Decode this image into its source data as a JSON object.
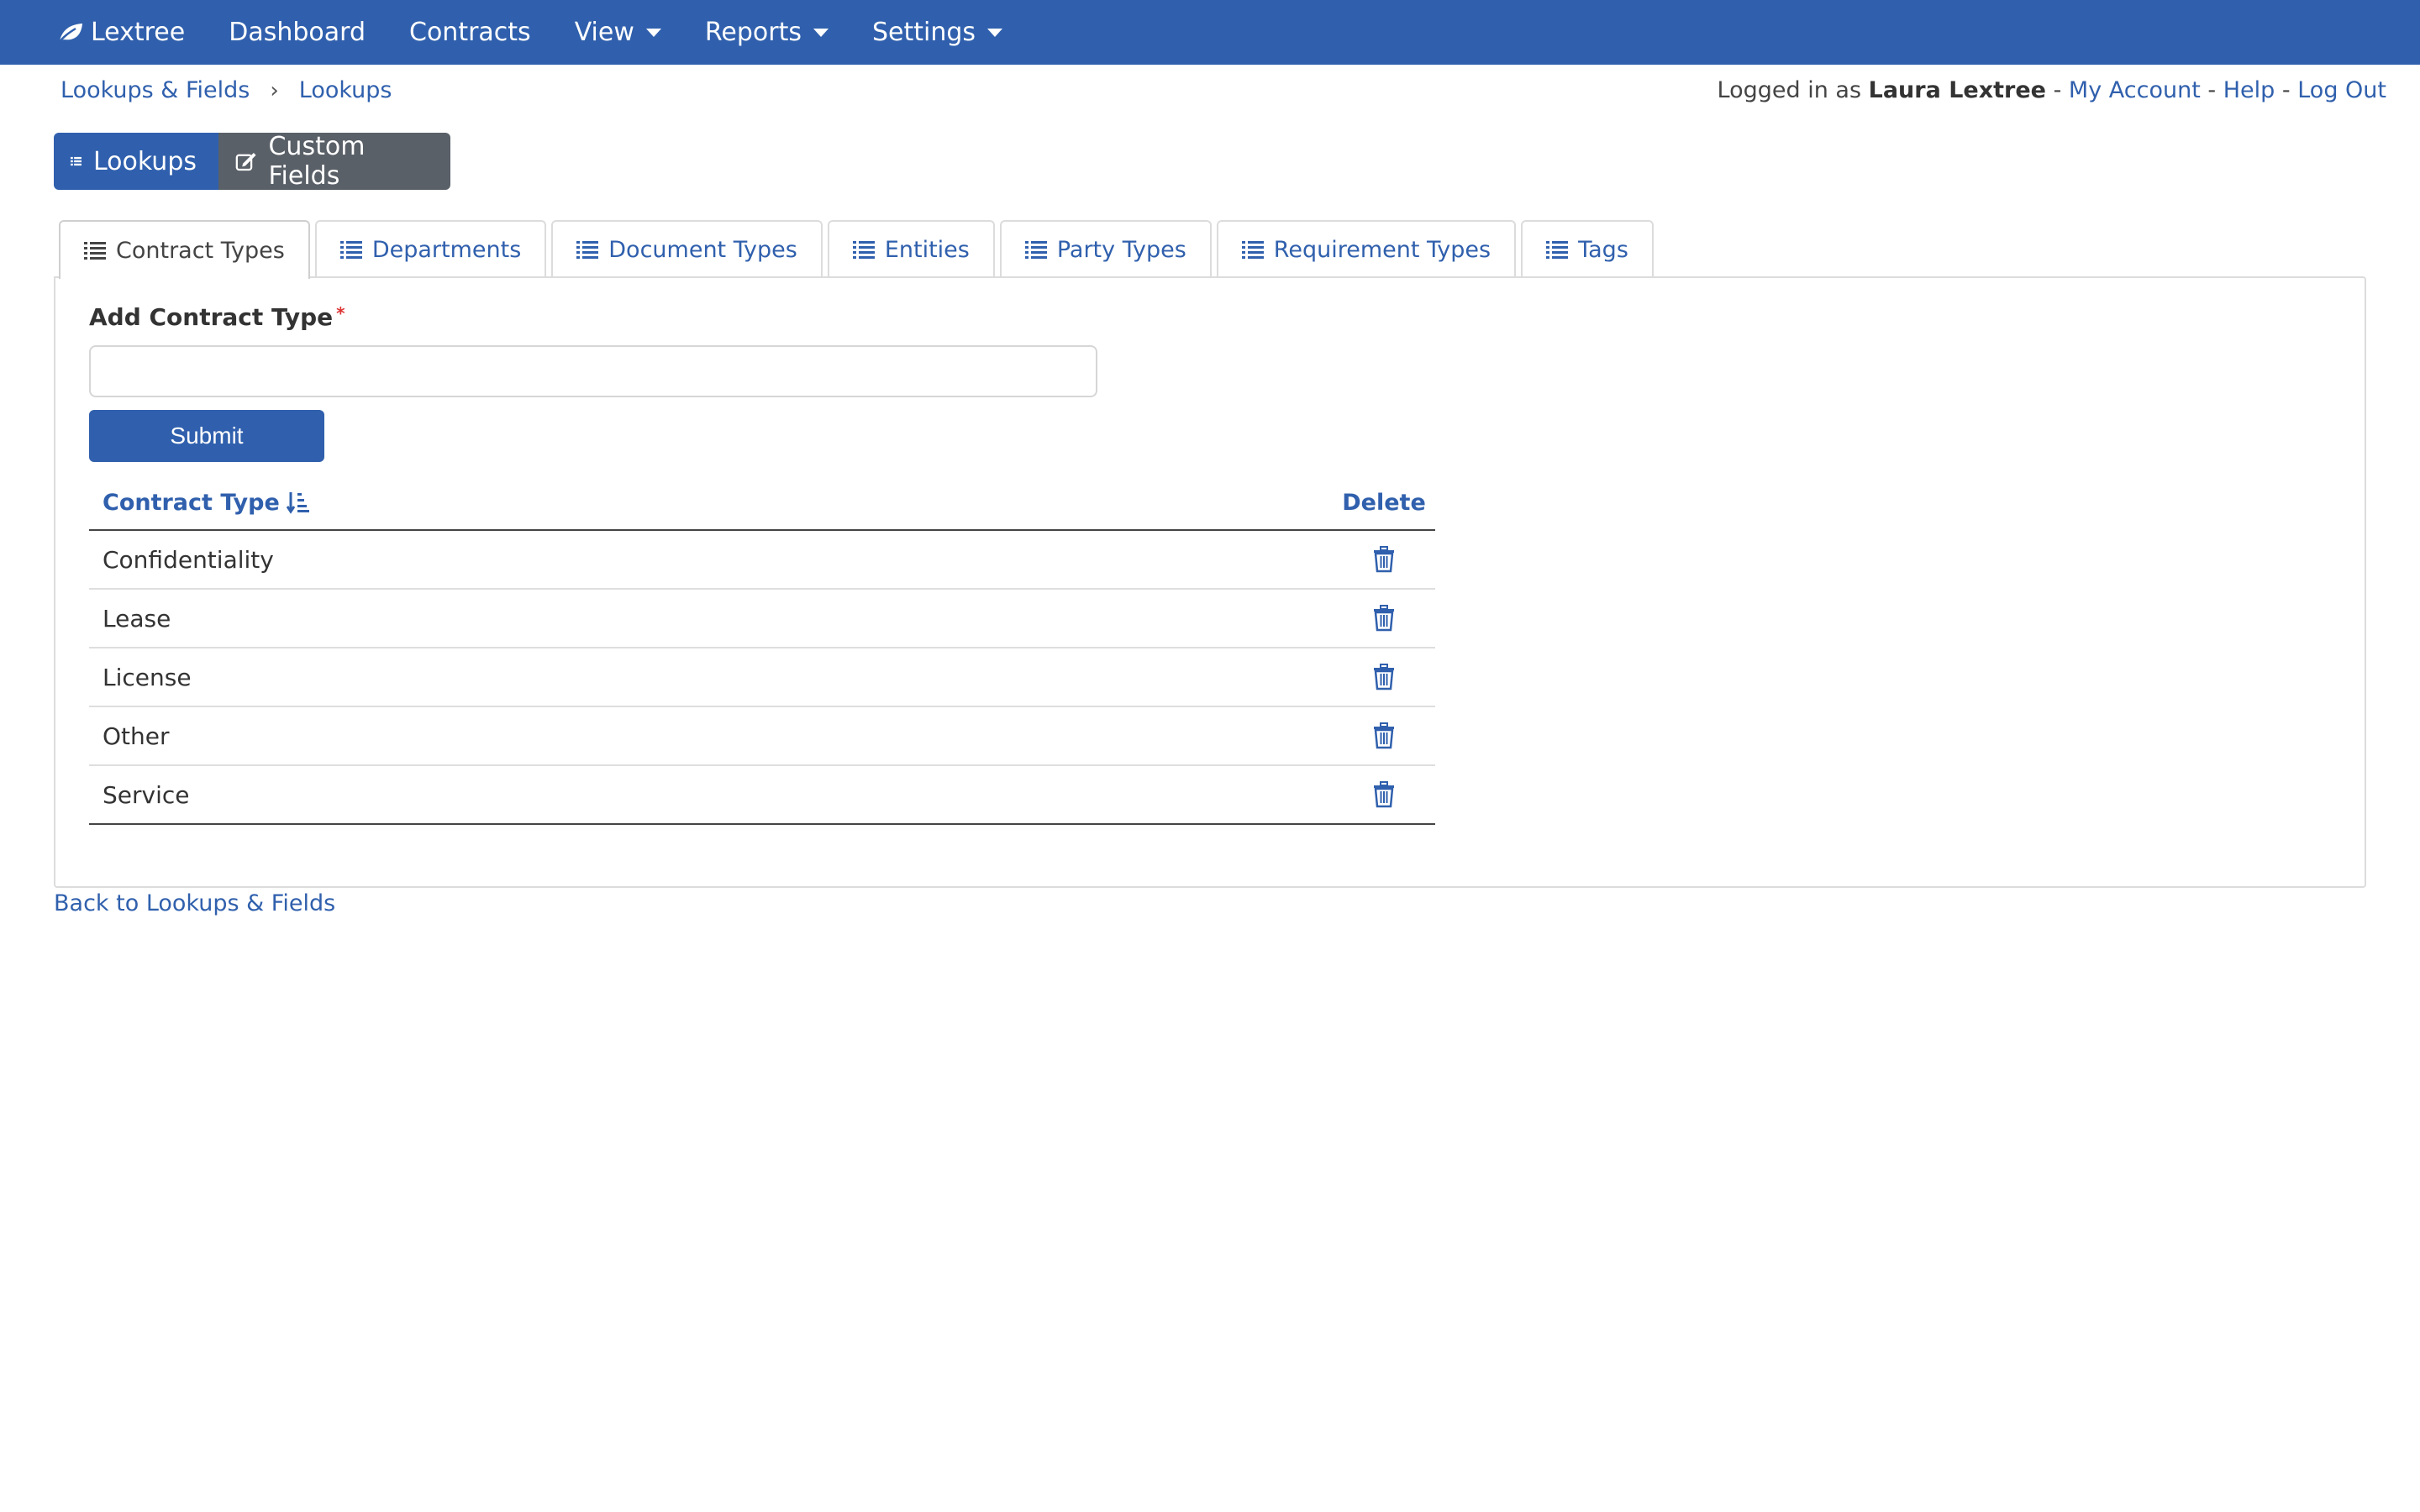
{
  "navbar": {
    "brand": "Lextree",
    "items": [
      {
        "label": "Dashboard"
      },
      {
        "label": "Contracts"
      },
      {
        "label": "View"
      },
      {
        "label": "Reports"
      },
      {
        "label": "Settings"
      }
    ]
  },
  "breadcrumb": {
    "items": [
      "Lookups & Fields",
      "Lookups"
    ],
    "separator": "›"
  },
  "user": {
    "prefix": "Logged in as",
    "name": "Laura Lextree",
    "sep": "-",
    "links": [
      "My Account",
      "Help",
      "Log Out"
    ]
  },
  "button_group": {
    "lookups": "Lookups",
    "custom_fields": "Custom Fields"
  },
  "tabs": [
    {
      "label": "Contract Types",
      "active": true
    },
    {
      "label": "Departments"
    },
    {
      "label": "Document Types"
    },
    {
      "label": "Entities"
    },
    {
      "label": "Party Types"
    },
    {
      "label": "Requirement Types"
    },
    {
      "label": "Tags"
    }
  ],
  "form": {
    "label": "Add Contract Type",
    "required_mark": "*",
    "value": "",
    "placeholder": "",
    "submit": "Submit"
  },
  "table": {
    "col_type": "Contract Type",
    "col_delete": "Delete",
    "rows": [
      "Confidentiality",
      "Lease",
      "License",
      "Other",
      "Service"
    ]
  },
  "back_link": "Back to Lookups & Fields",
  "colors": {
    "primary": "#3060ad",
    "secondary": "#5a6068"
  },
  "icons": {
    "brand": "leaf-icon",
    "list": "list-icon",
    "edit": "edit-icon",
    "sort": "sort-alpha-down-icon",
    "delete": "trash-icon"
  }
}
